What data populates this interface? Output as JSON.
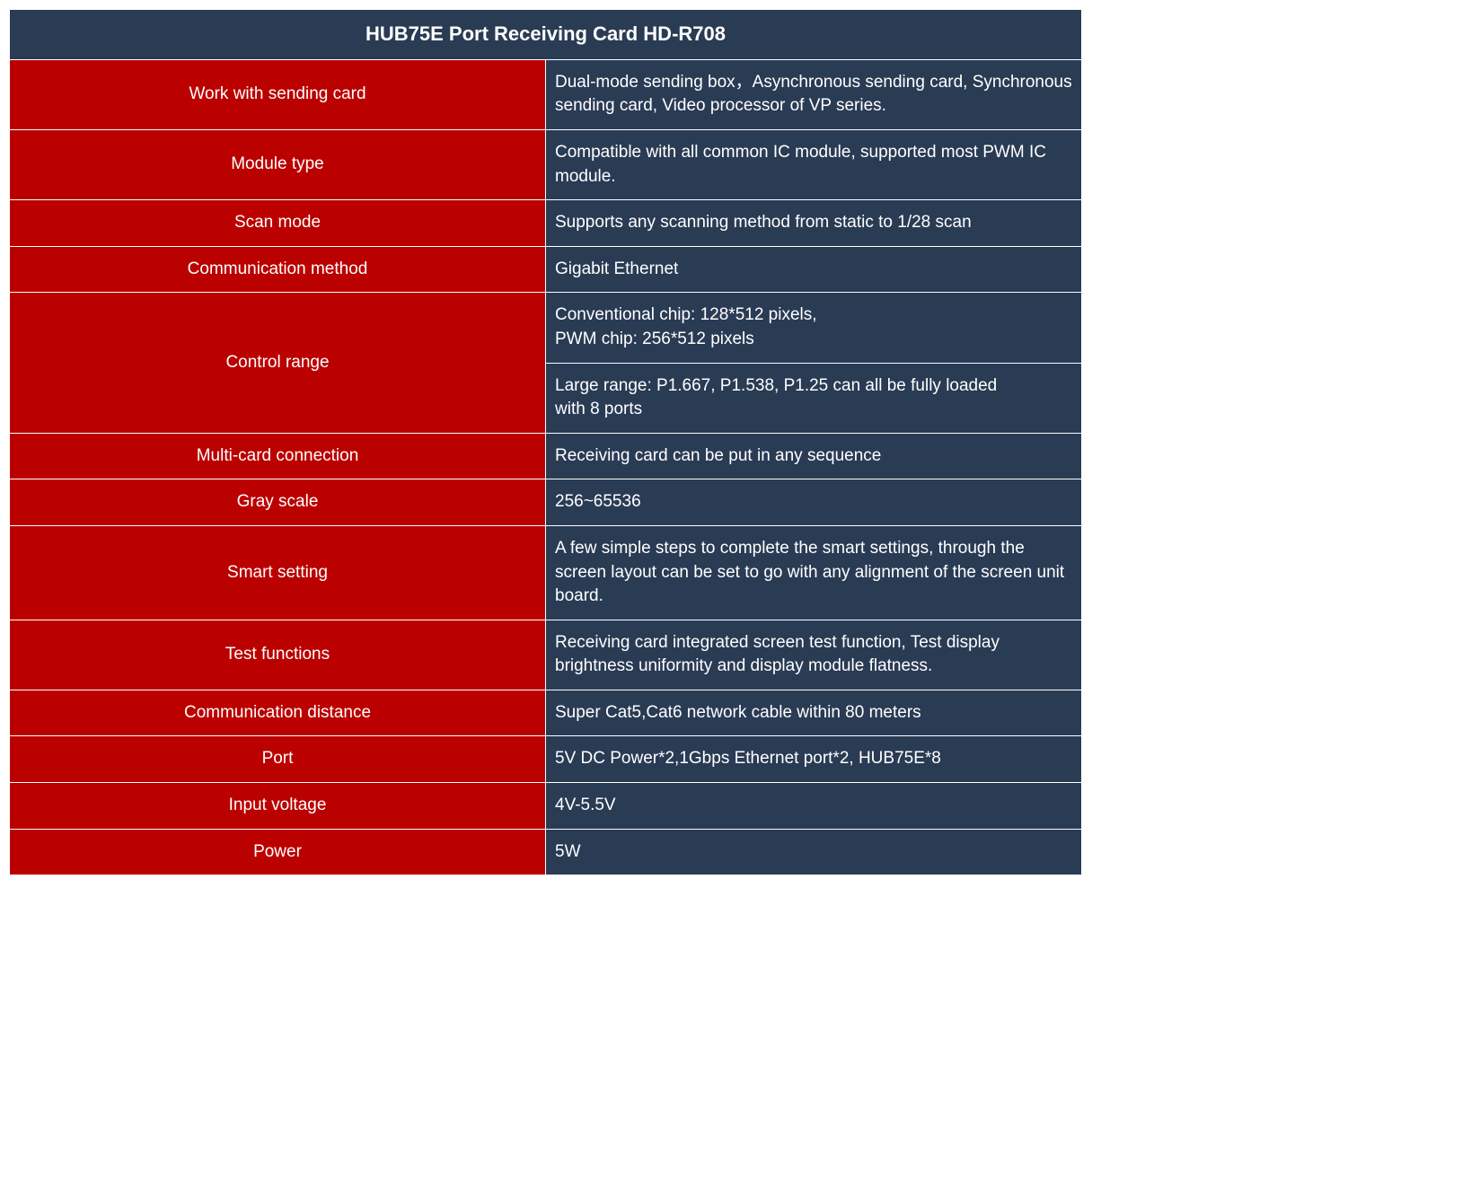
{
  "title": "HUB75E Port Receiving Card HD-R708",
  "rows": [
    {
      "label": "Work with  sending card",
      "value": "Dual-mode sending box，Asynchronous sending card, Synchronous sending card, Video processor of VP series."
    },
    {
      "label": "Module type",
      "value": "Compatible with all common IC module, supported most PWM  IC module."
    },
    {
      "label": "Scan mode",
      "value": "Supports any scanning method from static to 1/28 scan"
    },
    {
      "label": "Communication method",
      "value": "Gigabit Ethernet"
    },
    {
      "label": "Control range",
      "value_a": "Conventional chip: 128*512 pixels,\nPWM chip: 256*512 pixels",
      "value_b": "Large range: P1.667, P1.538, P1.25 can all be fully loaded\nwith 8 ports"
    },
    {
      "label": "Multi-card connection",
      "value": "Receiving card can be   put in any sequence"
    },
    {
      "label": "Gray scale",
      "value": "256~65536"
    },
    {
      "label": "Smart setting",
      "value": "A few simple steps to complete the smart settings,   through the screen layout can be set to go with any alignment of the screen unit board."
    },
    {
      "label": "Test functions",
      "value": "Receiving card integrated screen test function,   Test display brightness uniformity and display module flatness."
    },
    {
      "label": "Communication distance",
      "value": "Super Cat5,Cat6 network cable within 80 meters"
    },
    {
      "label": "Port",
      "value": "5V DC Power*2,1Gbps Ethernet port*2, HUB75E*8"
    },
    {
      "label": "Input voltage",
      "value": "4V-5.5V"
    },
    {
      "label": "Power",
      "value": "5W"
    }
  ]
}
